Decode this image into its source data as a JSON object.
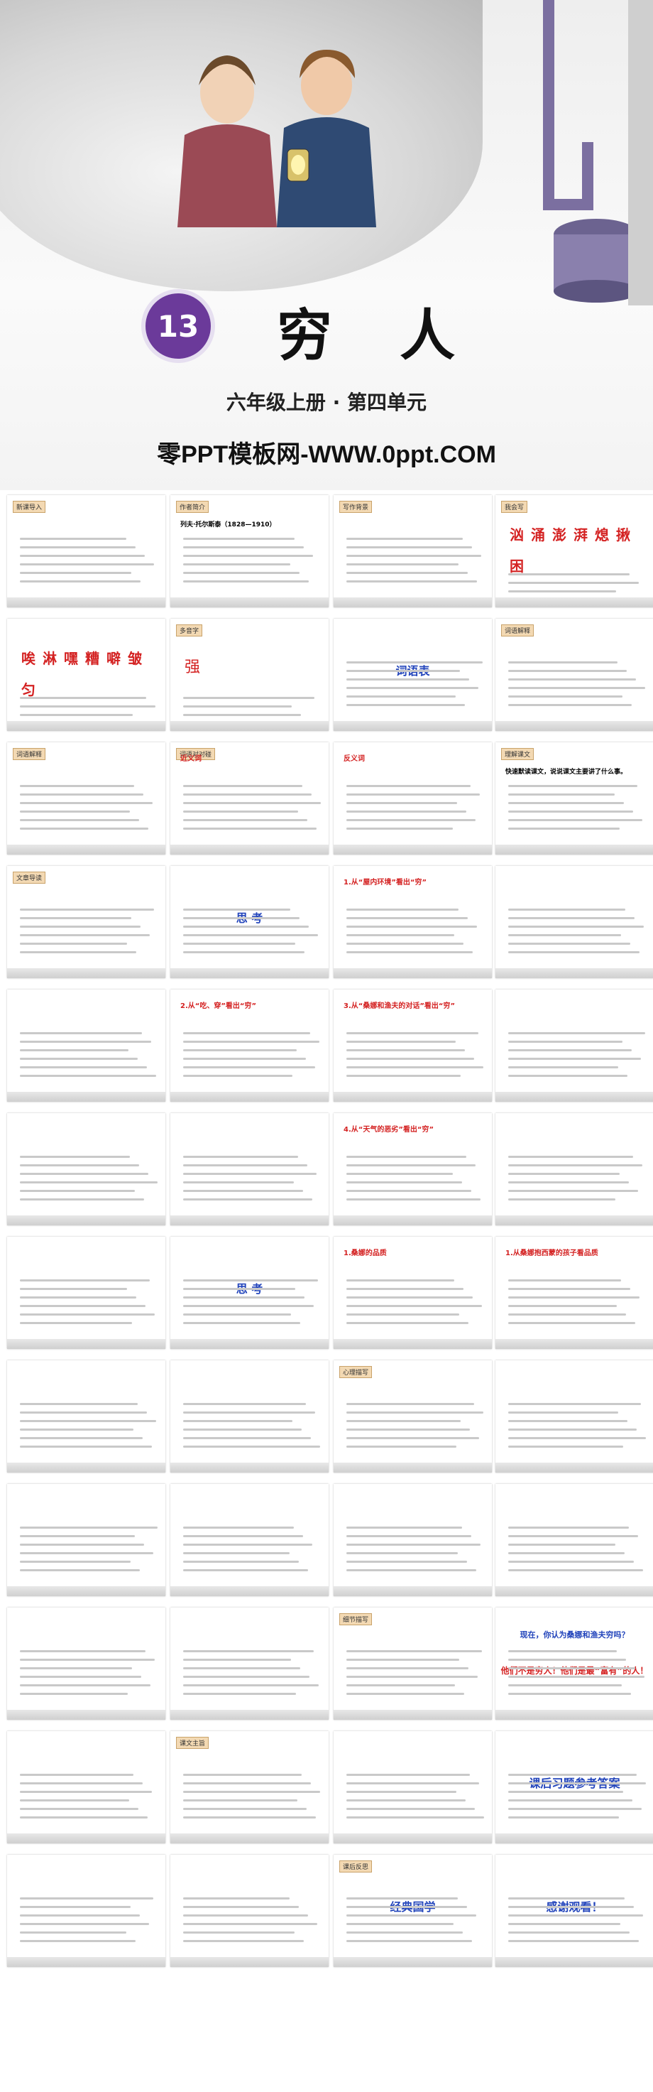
{
  "cover": {
    "lesson_number": "13",
    "title": "穷 人",
    "subtitle": "六年级上册 · 第四单元",
    "site": "零PPT模板网-WWW.0ppt.COM"
  },
  "slides": [
    {
      "tag": "新课导入"
    },
    {
      "tag": "作者简介",
      "text": "列夫·托尔斯泰（1828—1910）"
    },
    {
      "tag": "写作背景"
    },
    {
      "tag": "我会写",
      "chars": [
        "汹",
        "涌",
        "澎",
        "湃",
        "熄",
        "揪",
        "困"
      ]
    },
    {
      "chars": [
        "唉",
        "淋",
        "嘿",
        "糟",
        "噼",
        "皱",
        "匀"
      ]
    },
    {
      "tag": "多音字",
      "char": "强"
    },
    {
      "title": "词语表"
    },
    {
      "tag": "词语解释"
    },
    {
      "tag": "词语解释"
    },
    {
      "tag": "词语对对碰",
      "heading": "近义词"
    },
    {
      "heading": "反义词"
    },
    {
      "tag": "理解课文",
      "text": "快速默读课文，说说课文主要讲了什么事。"
    },
    {
      "tag": "文章导读"
    },
    {
      "title": "思 考"
    },
    {
      "heading": "1.从“屋内环境”看出“穷”"
    },
    {},
    {},
    {
      "heading": "2.从“吃、穿”看出“穷”"
    },
    {
      "heading": "3.从“桑娜和渔夫的对话”看出“穷”"
    },
    {},
    {},
    {},
    {
      "heading": "4.从“天气的恶劣”看出“穷”"
    },
    {},
    {},
    {
      "title": "思 考"
    },
    {
      "heading": "1.桑娜的品质"
    },
    {
      "heading": "1.从桑娜抱西蒙的孩子看品质"
    },
    {},
    {},
    {
      "tag": "心理描写"
    },
    {},
    {},
    {},
    {},
    {},
    {},
    {},
    {
      "tag": "细节描写"
    },
    {
      "title": "现在，你认为桑娜和渔夫穷吗？",
      "text": "他们不是穷人！他们是最“富有”的人！"
    },
    {},
    {
      "tag": "课文主旨"
    },
    {},
    {
      "title": "课后习题参考答案"
    },
    {},
    {},
    {
      "tag": "课后反思",
      "title": "经典国学"
    },
    {
      "title": "感谢观看！"
    }
  ]
}
